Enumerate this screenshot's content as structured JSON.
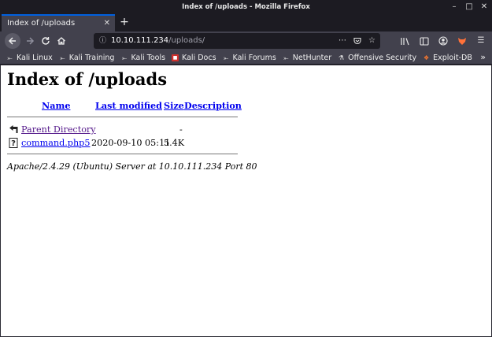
{
  "window": {
    "title": "Index of /uploads - Mozilla Firefox",
    "minimize": "–",
    "maximize": "□",
    "close": "✕"
  },
  "tab": {
    "title": "Index of /uploads",
    "close": "✕",
    "new_tab": "+"
  },
  "urlbar": {
    "host": "10.10.111.234",
    "path": "/uploads/"
  },
  "bookmarks": [
    {
      "label": "Kali Linux",
      "icon": "kali-dragon-icon"
    },
    {
      "label": "Kali Training",
      "icon": "kali-dragon-icon"
    },
    {
      "label": "Kali Tools",
      "icon": "kali-dragon-icon"
    },
    {
      "label": "Kali Docs",
      "icon": "kali-docs-icon"
    },
    {
      "label": "Kali Forums",
      "icon": "kali-dragon-icon"
    },
    {
      "label": "NetHunter",
      "icon": "kali-dragon-icon"
    },
    {
      "label": "Offensive Security",
      "icon": "offsec-icon"
    },
    {
      "label": "Exploit-DB",
      "icon": "exploit-db-icon"
    }
  ],
  "page": {
    "title": "Index of /uploads",
    "columns": [
      "Name",
      "Last modified",
      "Size",
      "Description"
    ],
    "parent": {
      "name": "Parent Directory",
      "size": "-"
    },
    "files": [
      {
        "name": "command.php5",
        "modified": "2020-09-10 05:11",
        "size": "5.4K",
        "description": ""
      }
    ],
    "footer": "Apache/2.4.29 (Ubuntu) Server at 10.10.111.234 Port 80"
  }
}
